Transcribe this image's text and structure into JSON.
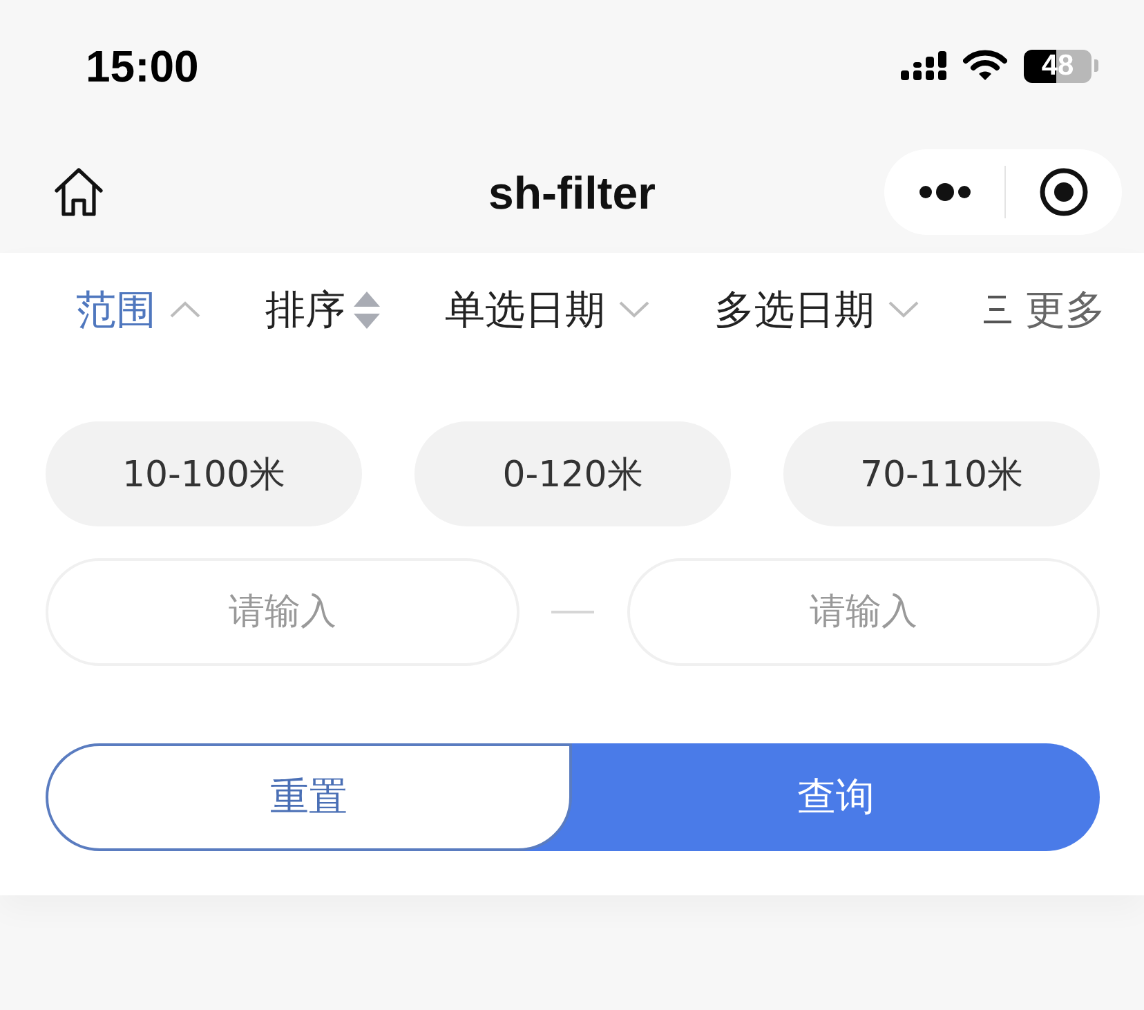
{
  "status_bar": {
    "time": "15:00",
    "battery": "48"
  },
  "nav_bar": {
    "title": "sh-filter"
  },
  "filter_tabs": [
    {
      "label": "范围",
      "kind": "dropdown",
      "selected": true,
      "expanded": true
    },
    {
      "label": "排序",
      "kind": "sort",
      "selected": false
    },
    {
      "label": "单选日期",
      "kind": "dropdown",
      "selected": false,
      "expanded": false
    },
    {
      "label": "多选日期",
      "kind": "dropdown",
      "selected": false,
      "expanded": false
    },
    {
      "label": "更多",
      "kind": "more",
      "selected": false
    }
  ],
  "range_options": [
    {
      "label": "10-100米",
      "selected": false
    },
    {
      "label": "0-120米",
      "selected": false
    },
    {
      "label": "70-110米",
      "selected": false
    }
  ],
  "range_inputs": [
    {
      "placeholder": "请输入"
    },
    {
      "placeholder": "请输入"
    }
  ],
  "actions": [
    {
      "label": "重置",
      "kind": "secondary"
    },
    {
      "label": "查询",
      "kind": "primary"
    }
  ]
}
